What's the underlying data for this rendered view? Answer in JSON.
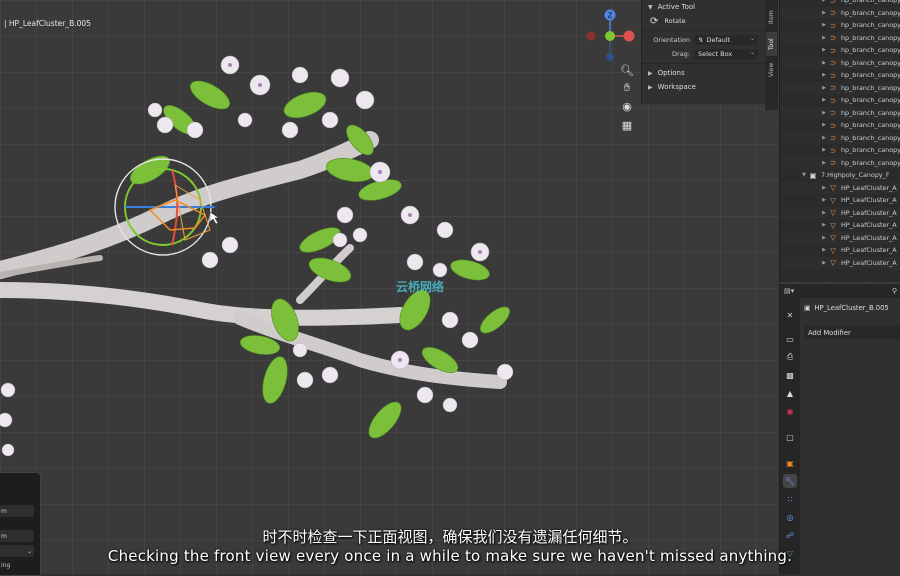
{
  "viewport": {
    "object_name": "| HP_LeafCluster_B.005",
    "watermark": "云桥网络"
  },
  "gizmo": {
    "axes": {
      "z": "Z",
      "y": "Y",
      "x": "X"
    }
  },
  "nav_buttons": [
    "zoom-icon",
    "hand-icon",
    "camera-icon",
    "grid-icon"
  ],
  "npanel": {
    "active_tool_header": "Active Tool",
    "tool_name": "Rotate",
    "orientation_label": "Orientation",
    "orientation_value": "Default",
    "drag_label": "Drag:",
    "drag_value": "Select Box",
    "options_header": "Options",
    "workspace_header": "Workspace"
  },
  "side_tabs": [
    "Item",
    "Tool",
    "View"
  ],
  "outliner": {
    "rows": [
      {
        "label": "hp_branch_canopy",
        "icon": "curve-icon"
      },
      {
        "label": "hp_branch_canopy",
        "icon": "curve-icon"
      },
      {
        "label": "hp_branch_canopy",
        "icon": "curve-icon"
      },
      {
        "label": "hp_branch_canopy",
        "icon": "curve-icon"
      },
      {
        "label": "hp_branch_canopy",
        "icon": "curve-icon"
      },
      {
        "label": "hp_branch_canopy",
        "icon": "curve-icon"
      },
      {
        "label": "hp_branch_canopy",
        "icon": "curve-icon"
      },
      {
        "label": "hp_branch_canopy",
        "icon": "curve-icon"
      },
      {
        "label": "hp_branch_canopy",
        "icon": "curve-icon"
      },
      {
        "label": "hp_branch_canopy",
        "icon": "curve-icon"
      },
      {
        "label": "hp_branch_canopy",
        "icon": "curve-icon"
      },
      {
        "label": "hp_branch_canopy",
        "icon": "curve-icon"
      },
      {
        "label": "hp_branch_canopy",
        "icon": "curve-icon"
      },
      {
        "label": "hp_branch_canopy",
        "icon": "curve-icon"
      },
      {
        "label": "7.Highpoly_Canopy_F",
        "icon": "collection-icon",
        "collection": true
      },
      {
        "label": "HP_LeafCluster_A",
        "icon": "mesh-icon"
      },
      {
        "label": "HP_LeafCluster_A",
        "icon": "mesh-icon"
      },
      {
        "label": "HP_LeafCluster_A",
        "icon": "mesh-icon"
      },
      {
        "label": "HP_LeafCluster_A",
        "icon": "mesh-icon"
      },
      {
        "label": "HP_LeafCluster_A",
        "icon": "mesh-icon"
      },
      {
        "label": "HP_LeafCluster_A",
        "icon": "mesh-icon"
      },
      {
        "label": "HP_LeafCluster_A",
        "icon": "mesh-icon"
      }
    ]
  },
  "properties": {
    "object_name": "HP_LeafCluster_B.005",
    "add_modifier": "Add Modifier"
  },
  "bottom_left": {
    "fields": [
      "m",
      "m",
      "ing"
    ]
  },
  "subtitles": {
    "chinese": "时不时检查一下正面视图，确保我们没有遗漏任何细节。",
    "english": "Checking the front view every once in a while to make sure we haven't missed anything."
  }
}
